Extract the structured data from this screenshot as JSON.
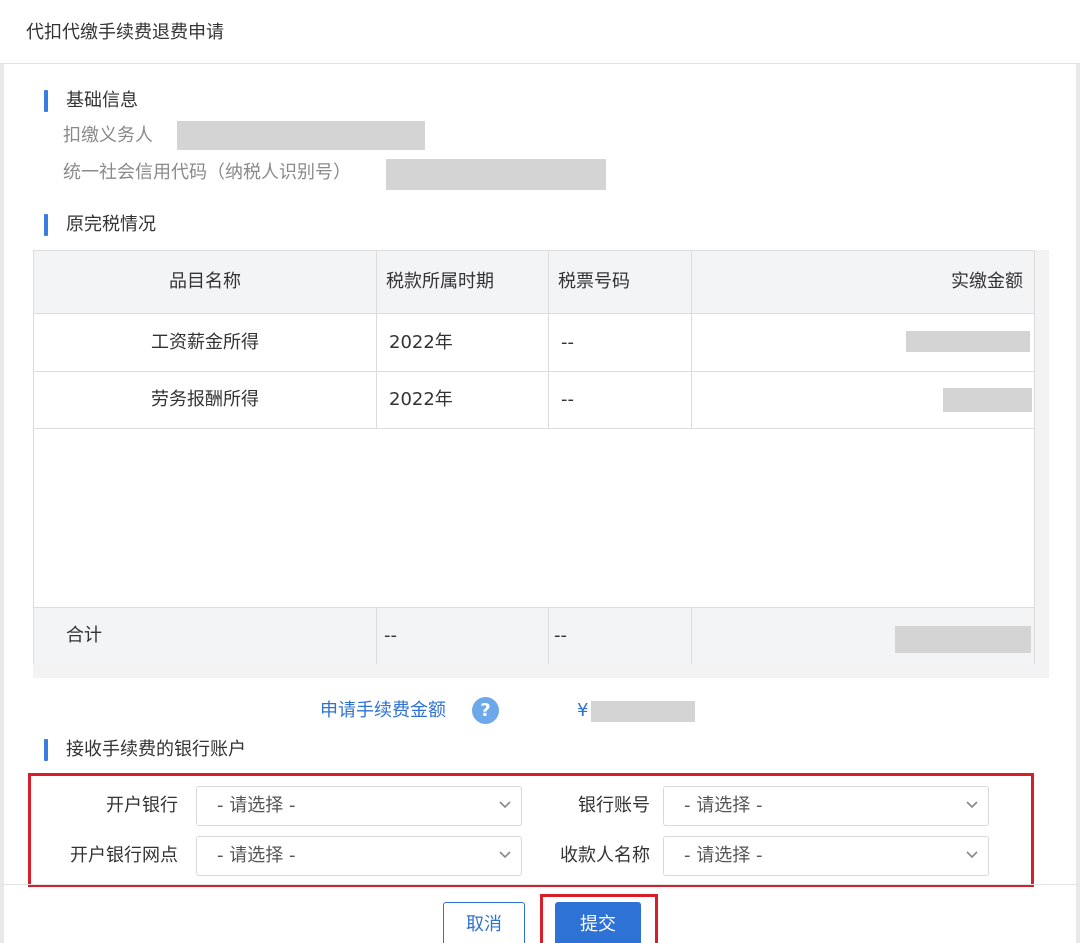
{
  "dialog": {
    "title": "代扣代缴手续费退费申请"
  },
  "basic_info": {
    "heading": "基础信息",
    "withholder_label": "扣缴义务人",
    "credit_code_label": "统一社会信用代码（纳税人识别号）"
  },
  "original_tax": {
    "heading": "原完税情况",
    "columns": [
      "品目名称",
      "税款所属时期",
      "税票号码",
      "实缴金额"
    ],
    "rows": [
      {
        "item": "工资薪金所得",
        "period": "2022年",
        "ticket": "--"
      },
      {
        "item": "劳务报酬所得",
        "period": "2022年",
        "ticket": "--"
      }
    ],
    "total": {
      "label": "合计",
      "period": "--",
      "ticket": "--"
    }
  },
  "fee": {
    "label": "申请手续费金额",
    "help_icon": "question-icon",
    "currency": "¥"
  },
  "bank_account": {
    "heading": "接收手续费的银行账户",
    "fields": {
      "bank": {
        "label": "开户银行",
        "value": "- 请选择 -"
      },
      "account": {
        "label": "银行账号",
        "value": "- 请选择 -"
      },
      "branch": {
        "label": "开户银行网点",
        "value": "- 请选择 -"
      },
      "payee": {
        "label": "收款人名称",
        "value": "- 请选择 -"
      }
    }
  },
  "actions": {
    "cancel": "取消",
    "submit": "提交"
  },
  "colors": {
    "accent": "#2f72d6",
    "highlight": "#d81e2a",
    "section_bar": "#3a7de0"
  }
}
